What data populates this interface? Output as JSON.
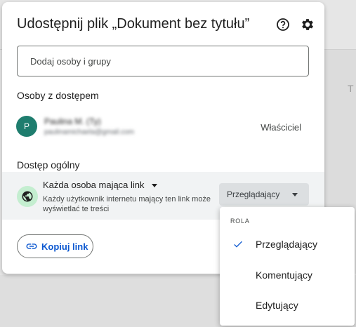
{
  "dialog": {
    "title": "Udostępnij plik „Dokument bez tytułu”",
    "help_icon": "help-circle-icon",
    "settings_icon": "gear-icon",
    "add_input": {
      "placeholder": "Dodaj osoby i grupy"
    },
    "people_heading": "Osoby z dostępem",
    "person": {
      "initial": "P",
      "name": "Paulina M. (Ty)",
      "email": "paulinamichaela@gmail.com",
      "role": "Właściciel"
    },
    "general_heading": "Dostęp ogólny",
    "general_access": {
      "scope": "Każda osoba mająca link",
      "description": "Każdy użytkownik internetu mający ten link może wyświetlać te treści",
      "role": "Przeglądający"
    },
    "copy_link": "Kopiuj link"
  },
  "role_menu": {
    "heading": "ROLA",
    "items": [
      {
        "label": "Przeglądający",
        "selected": true
      },
      {
        "label": "Komentujący",
        "selected": false
      },
      {
        "label": "Edytujący",
        "selected": false
      }
    ]
  },
  "colors": {
    "accent": "#0b57d0",
    "globe_bg": "#c4eed0",
    "avatar": "#1e7d6e"
  }
}
